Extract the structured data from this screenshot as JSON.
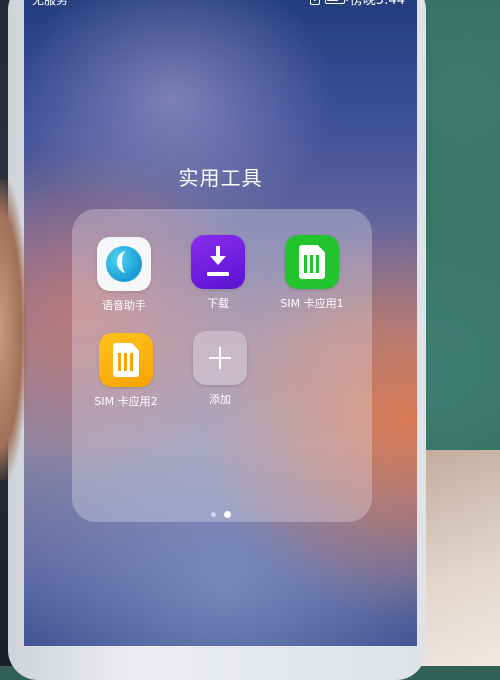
{
  "status_bar": {
    "carrier": "无服务",
    "time": "傍晚5:44",
    "sim_badge": "!",
    "battery_level": 0.7
  },
  "folder": {
    "title": "实用工具",
    "apps": [
      {
        "label": "语音助手",
        "icon": "voice-assistant-icon",
        "color": "#1a9ad6"
      },
      {
        "label": "下载",
        "icon": "download-icon",
        "color": "#6a1ae0"
      },
      {
        "label": "SIM 卡应用1",
        "icon": "sim-card-icon",
        "color": "#22c42e"
      },
      {
        "label": "SIM 卡应用2",
        "icon": "sim-card-icon",
        "color": "#f7a400"
      },
      {
        "label": "添加",
        "icon": "plus-icon",
        "color": "#ffffff"
      }
    ],
    "pages": {
      "count": 2,
      "current": 2
    }
  }
}
